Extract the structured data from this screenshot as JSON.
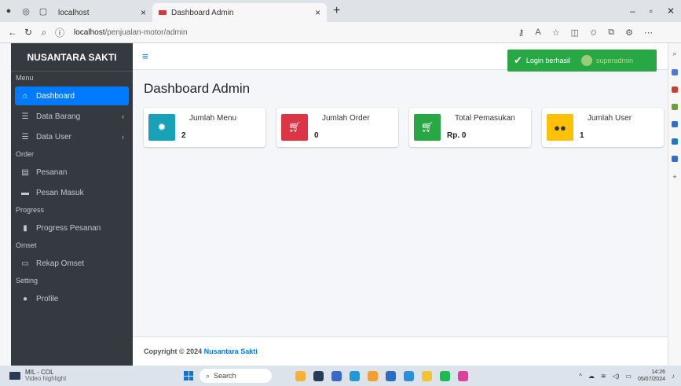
{
  "browser": {
    "tab1_title": "localhost",
    "tab2_title": "Dashboard Admin",
    "url_host": "localhost",
    "url_path": "/penjualan-motor/admin"
  },
  "sidebar": {
    "brand": "NUSANTARA SAKTI",
    "sections": {
      "menu": "Menu",
      "order": "Order",
      "progress": "Progress",
      "omset": "Omset",
      "setting": "Setting"
    },
    "items": {
      "dashboard": "Dashboard",
      "data_barang": "Data Barang",
      "data_user": "Data User",
      "pesanan": "Pesanan",
      "pesan_masuk": "Pesan Masuk",
      "progress_pesanan": "Progress Pesanan",
      "rekap_omset": "Rekap Omset",
      "profile": "Profile"
    }
  },
  "toast": {
    "message": "Login berhasil",
    "user": "superadmin"
  },
  "page": {
    "title": "Dashboard Admin"
  },
  "cards": [
    {
      "label": "Jumlah Menu",
      "value": "2",
      "color": "#17a2b8",
      "icon": "gear-icon"
    },
    {
      "label": "Jumlah Order",
      "value": "0",
      "color": "#dc3545",
      "icon": "cart-icon"
    },
    {
      "label": "Total Pemasukan",
      "value": "Rp. 0",
      "color": "#28a745",
      "icon": "cart-icon"
    },
    {
      "label": "Jumlah User",
      "value": "1",
      "color": "#ffc107",
      "icon": "users-icon"
    }
  ],
  "footer": {
    "prefix": "Copyright © 2024",
    "brand": "Nusantara Sakti"
  },
  "taskbar": {
    "note_title": "MIL - COL",
    "note_sub": "Video highlight",
    "search_label": "Search",
    "time": "14:26",
    "date": "05/07/2024"
  }
}
